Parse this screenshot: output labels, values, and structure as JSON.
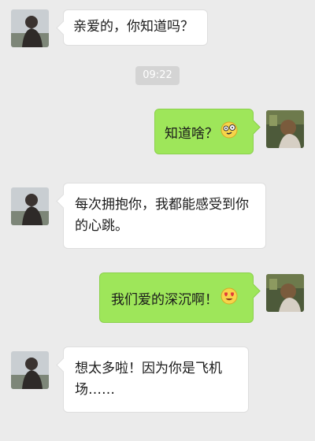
{
  "chat": {
    "timestamp": "09:22",
    "messages": [
      {
        "sender": "other",
        "text": "亲爱的，你知道吗？"
      },
      {
        "sender": "self",
        "text": "知道啥？",
        "emoji": "dizzy-face-emoji"
      },
      {
        "sender": "other",
        "text": "每次拥抱你，我都能感受到你的心跳。"
      },
      {
        "sender": "self",
        "text": "我们爱的深沉啊！",
        "emoji": "heart-eyes-emoji"
      },
      {
        "sender": "other",
        "text": "想太多啦！因为你是飞机场……"
      }
    ]
  },
  "colors": {
    "background": "#ebebeb",
    "incoming_bubble": "#ffffff",
    "outgoing_bubble": "#9ee65a",
    "timestamp_badge": "#d4d4d4"
  }
}
